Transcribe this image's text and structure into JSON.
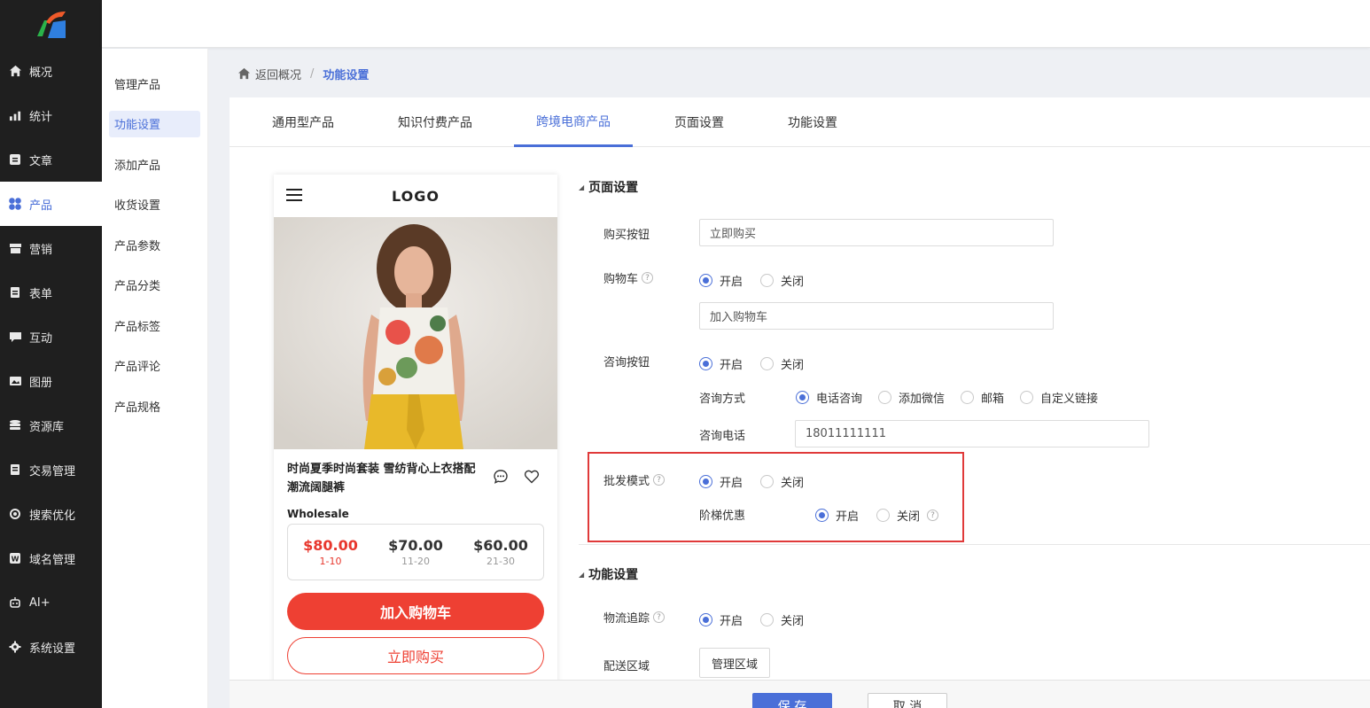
{
  "nav": {
    "items": [
      {
        "label": "概况",
        "icon": "home-icon"
      },
      {
        "label": "统计",
        "icon": "stats-icon"
      },
      {
        "label": "文章",
        "icon": "article-icon"
      },
      {
        "label": "产品",
        "icon": "product-icon",
        "active": true
      },
      {
        "label": "营销",
        "icon": "marketing-icon"
      },
      {
        "label": "表单",
        "icon": "form-icon"
      },
      {
        "label": "互动",
        "icon": "chat-icon"
      },
      {
        "label": "图册",
        "icon": "gallery-icon"
      },
      {
        "label": "资源库",
        "icon": "database-icon"
      },
      {
        "label": "交易管理",
        "icon": "order-icon"
      },
      {
        "label": "搜索优化",
        "icon": "seo-icon"
      },
      {
        "label": "域名管理",
        "icon": "domain-icon"
      },
      {
        "label": "AI+",
        "icon": "robot-icon"
      },
      {
        "label": "系统设置",
        "icon": "gear-icon"
      }
    ]
  },
  "subnav": {
    "items": [
      "管理产品",
      "功能设置",
      "添加产品",
      "收货设置",
      "产品参数",
      "产品分类",
      "产品标签",
      "产品评论",
      "产品规格"
    ],
    "active": "功能设置"
  },
  "breadcrumb": {
    "back": "返回概况",
    "separator": "/",
    "current": "功能设置"
  },
  "tabs": [
    "通用型产品",
    "知识付费产品",
    "跨境电商产品",
    "页面设置",
    "功能设置"
  ],
  "active_tab": "跨境电商产品",
  "preview": {
    "logo": "LOGO",
    "product_title": "时尚夏季时尚套装 雪纺背心上衣搭配潮流阔腿裤",
    "wholesale_label": "Wholesale",
    "prices": [
      {
        "price": "$80.00",
        "range": "1-10"
      },
      {
        "price": "$70.00",
        "range": "11-20"
      },
      {
        "price": "$60.00",
        "range": "21-30"
      }
    ],
    "add_cart": "加入购物车",
    "buy_now": "立即购买"
  },
  "page_settings": {
    "title": "页面设置",
    "buy_button": {
      "label": "购买按钮",
      "value": "立即购买"
    },
    "cart": {
      "label": "购物车",
      "on": "开启",
      "off": "关闭",
      "selected": "on",
      "value": "加入购物车"
    },
    "consult": {
      "label": "咨询按钮",
      "on": "开启",
      "off": "关闭",
      "selected": "on",
      "method_label": "咨询方式",
      "methods": [
        "电话咨询",
        "添加微信",
        "邮箱",
        "自定义链接"
      ],
      "method_selected": "电话咨询",
      "phone_label": "咨询电话",
      "phone_value": "18011111111"
    },
    "wholesale": {
      "label": "批发模式",
      "on": "开启",
      "off": "关闭",
      "selected": "on"
    },
    "tier_discount": {
      "label": "阶梯优惠",
      "on": "开启",
      "off": "关闭",
      "selected": "on"
    }
  },
  "function_settings": {
    "title": "功能设置",
    "tracking": {
      "label": "物流追踪",
      "on": "开启",
      "off": "关闭",
      "selected": "on"
    },
    "delivery": {
      "label": "配送区域",
      "button": "管理区域"
    }
  },
  "actions": {
    "save": "保 存",
    "cancel": "取 消"
  },
  "colors": {
    "accent": "#4a6fd8",
    "danger": "#ee4033",
    "nav_bg": "#1f1f1f"
  }
}
